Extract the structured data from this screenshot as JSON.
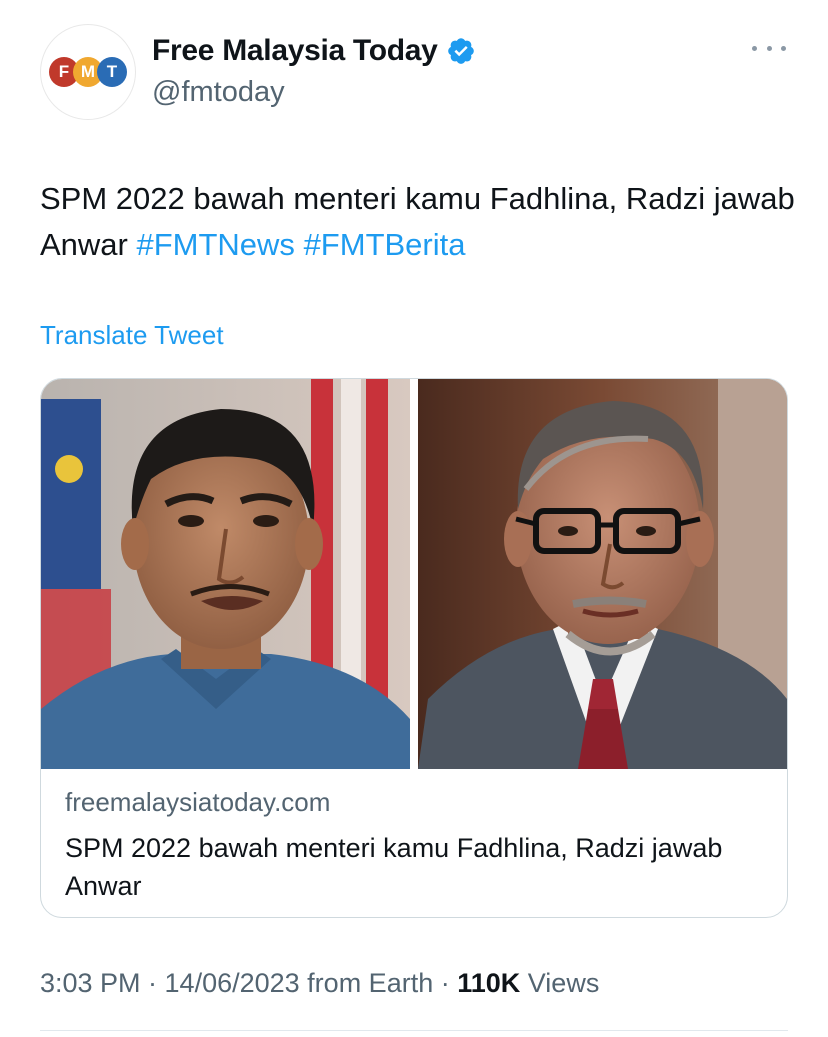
{
  "tweet": {
    "avatar": {
      "logo_letters": [
        "F",
        "M",
        "T"
      ],
      "logo_colors": [
        "#c0392b",
        "#f0a830",
        "#2a6cb5"
      ]
    },
    "display_name": "Free Malaysia Today",
    "verified_icon": "verified-badge-icon",
    "handle": "@fmtoday",
    "more_icon": "more-horizontal-icon",
    "text_main": "SPM 2022 bawah menteri kamu Fadhlina, Radzi jawab Anwar ",
    "hashtags": [
      "#FMTNews",
      "#FMTBerita"
    ],
    "translate_label": "Translate Tweet",
    "timestamp": "3:03 PM · 14/06/2023 from Earth · ",
    "views_count": "110K",
    "views_label": " Views"
  },
  "link_card": {
    "domain": "freemalaysiatoday.com",
    "title": "SPM 2022 bawah menteri kamu Fadhlina, Radzi jawab Anwar",
    "images": [
      "photo-of-man-in-blue-shirt",
      "photo-of-man-with-glasses-in-suit"
    ]
  },
  "colors": {
    "link": "#1d9bf0",
    "text": "#0f1419",
    "secondary": "#536471",
    "verified": "#1d9bf0"
  }
}
